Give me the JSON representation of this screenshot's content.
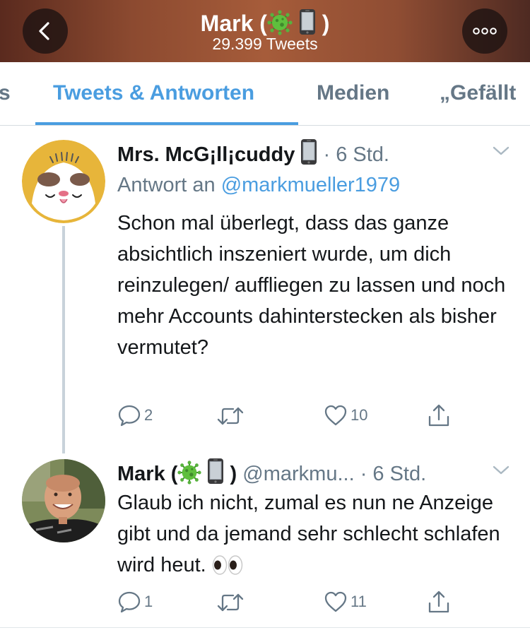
{
  "header": {
    "title_name": "Mark (",
    "title_close": ")",
    "subtitle": "29.399 Tweets"
  },
  "tabs": [
    {
      "label": "s",
      "active": false
    },
    {
      "label": "Tweets & Antworten",
      "active": true
    },
    {
      "label": "Medien",
      "active": false
    },
    {
      "label": "„Gefällt",
      "active": false
    }
  ],
  "tweets": [
    {
      "name": "Mrs. McG¡ll¡cuddy",
      "time": "· 6 Std.",
      "reply_prefix": "Antwort an",
      "reply_handle": "@markmueller1979",
      "body": "Schon mal überlegt, dass das ganze absichtlich inszeniert wurde, um dich reinzulegen/ auffliegen zu lassen und noch mehr Accounts dahinterstecken als bisher vermutet?",
      "replies": "2",
      "retweets": "",
      "likes": "10"
    },
    {
      "name": "Mark (",
      "name_close": ")",
      "handle": "@markmu...",
      "time": "· 6 Std.",
      "body": "Glaub ich nicht, zumal es nun ne Anzeige gibt und da jemand sehr schlecht schlafen wird heut.",
      "replies": "1",
      "retweets": "",
      "likes": "11"
    }
  ],
  "colors": {
    "accent": "#4a9de0",
    "muted": "#657786",
    "text": "#14171a"
  },
  "icons": {
    "back": "chevron-left-icon",
    "more": "more-dots-icon",
    "reply": "reply-bubble-icon",
    "retweet": "retweet-icon",
    "like": "heart-icon",
    "share": "share-icon",
    "caret": "chevron-down-icon"
  }
}
